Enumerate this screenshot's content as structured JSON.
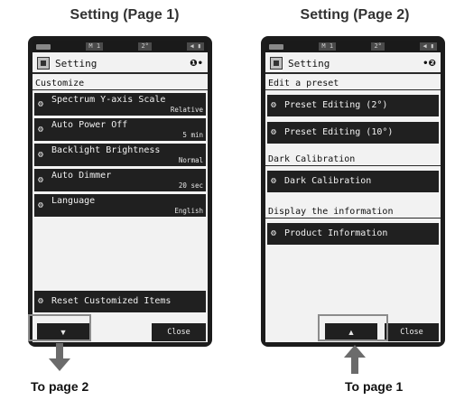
{
  "captions": {
    "page1": "Setting (Page 1)",
    "page2": "Setting (Page 2)"
  },
  "statusbar": {
    "mode": "M 1",
    "angle": "2°",
    "icons": "◀ ▮"
  },
  "page1": {
    "title": "Setting",
    "page_indicator": "❶•",
    "section": "Customize",
    "items": [
      {
        "label": "Spectrum Y-axis Scale",
        "value": "Relative"
      },
      {
        "label": "Auto Power Off",
        "value": "5 min"
      },
      {
        "label": "Backlight Brightness",
        "value": "Normal"
      },
      {
        "label": "Auto Dimmer",
        "value": "20 sec"
      },
      {
        "label": "Language",
        "value": "English"
      }
    ],
    "reset_label": "Reset Customized Items",
    "down_icon": "▼",
    "close_label": "Close",
    "footer": "To page 2"
  },
  "page2": {
    "title": "Setting",
    "page_indicator": "•❷",
    "sections": [
      {
        "title": "Edit a preset",
        "items": [
          "Preset Editing (2°)",
          "Preset Editing (10°)"
        ]
      },
      {
        "title": "Dark Calibration",
        "items": [
          "Dark Calibration"
        ]
      },
      {
        "title": "Display the information",
        "items": [
          "Product Information"
        ]
      }
    ],
    "up_icon": "▲",
    "close_label": "Close",
    "footer": "To page 1"
  },
  "colors": {
    "device_frame": "#1c1c1c",
    "screen_bg": "#f2f2f2",
    "button_bg": "#202020",
    "highlight": "#8c8c8c",
    "arrow": "#6b6b6b"
  },
  "icons": {
    "gear": "gear-icon",
    "setting": "setting-icon",
    "down": "down-arrow-icon",
    "up": "up-arrow-icon"
  }
}
